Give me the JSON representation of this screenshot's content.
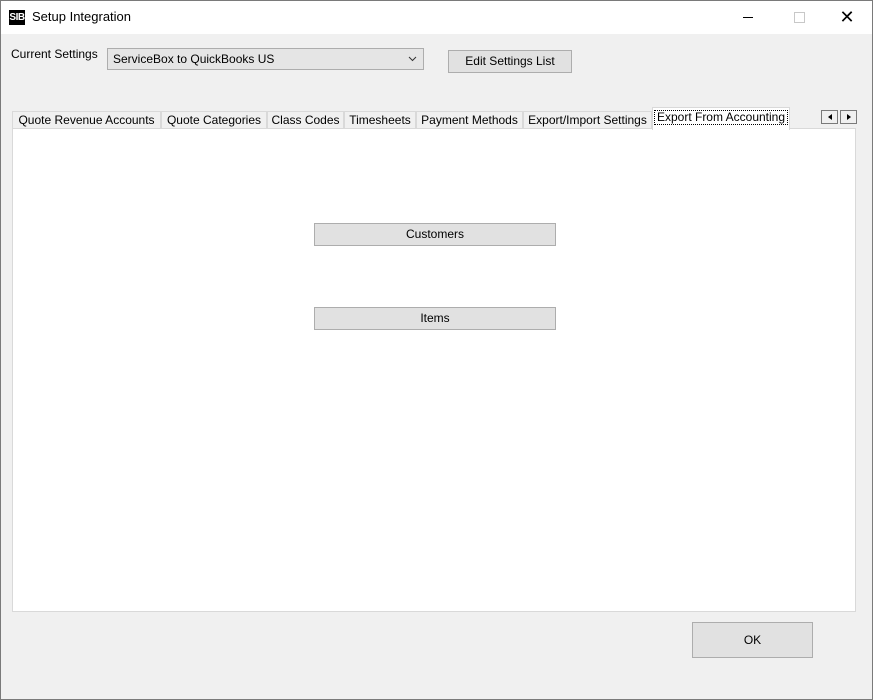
{
  "window": {
    "title": "Setup Integration",
    "icon_text": "SIB",
    "controls": {
      "minimize": "minimize",
      "maximize": "maximize",
      "close": "✕"
    }
  },
  "settings": {
    "label": "Current Settings",
    "selected": "ServiceBox to QuickBooks US",
    "edit_button": "Edit Settings List"
  },
  "tabs": [
    {
      "label": "Quote Revenue Accounts",
      "active": false
    },
    {
      "label": "Quote Categories",
      "active": false
    },
    {
      "label": "Class Codes",
      "active": false
    },
    {
      "label": "Timesheets",
      "active": false
    },
    {
      "label": "Payment Methods",
      "active": false
    },
    {
      "label": "Export/Import Settings",
      "active": false
    },
    {
      "label": "Export From Accounting",
      "active": true
    }
  ],
  "panel": {
    "customers_button": "Customers",
    "items_button": "Items"
  },
  "footer": {
    "ok_button": "OK"
  },
  "colors": {
    "window_bg": "#f0f0f0",
    "button_bg": "#e1e1e1",
    "button_border": "#adadad",
    "panel_bg": "#ffffff"
  }
}
